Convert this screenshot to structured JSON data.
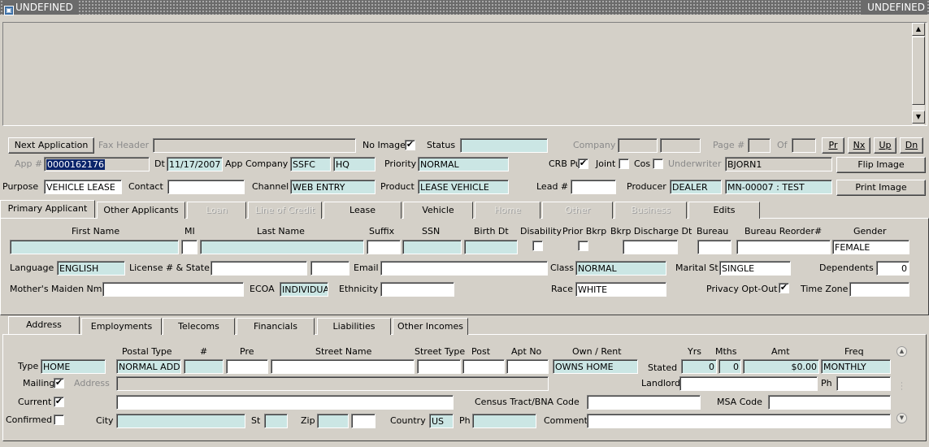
{
  "window": {
    "title": "UNDEFINED",
    "title_right": "UNDEFINED"
  },
  "header": {
    "next_application": "Next Application",
    "fax_header_label": "Fax Header",
    "fax_header_value": "",
    "no_image_label": "No Image",
    "no_image_checked": true,
    "status_label": "Status",
    "status_value": "",
    "company_label": "Company",
    "company_value1": "",
    "company_value2": "",
    "page_label": "Page #",
    "page_value": "",
    "of_label": "Of",
    "of_value": "",
    "nav_buttons": [
      "Pr",
      "Nx",
      "Up",
      "Dn"
    ],
    "app_label": "App #",
    "app_value": "0000162176",
    "dt_label": "Dt",
    "dt_value": "11/17/2007",
    "app_company_label": "App Company",
    "app_company_value": "SSFC",
    "app_company_branch": "HQ",
    "priority_label": "Priority",
    "priority_value": "NORMAL",
    "crb_pull_label": "CRB Pull",
    "crb_pull_checked": true,
    "joint_label": "Joint",
    "joint_checked": false,
    "cos_label": "Cos",
    "cos_checked": false,
    "underwriter_label": "Underwriter",
    "underwriter_value": "BJORN1",
    "flip_image": "Flip Image",
    "purpose_label": "Purpose",
    "purpose_value": "VEHICLE LEASE",
    "contact_label": "Contact",
    "contact_value": "",
    "channel_label": "Channel",
    "channel_value": "WEB ENTRY",
    "product_label": "Product",
    "product_value": "LEASE VEHICLE",
    "lead_label": "Lead #",
    "lead_value": "",
    "producer_label": "Producer",
    "producer_value": "DEALER",
    "producer_detail": "MN-00007 : TEST",
    "print_image": "Print Image"
  },
  "main_tabs": [
    {
      "label": "Primary Applicant",
      "state": "active"
    },
    {
      "label": "Other Applicants",
      "state": "normal"
    },
    {
      "label": "Loan",
      "state": "disabled"
    },
    {
      "label": "Line of Credit",
      "state": "disabled"
    },
    {
      "label": "Lease",
      "state": "normal"
    },
    {
      "label": "Vehicle",
      "state": "normal"
    },
    {
      "label": "Home",
      "state": "disabled"
    },
    {
      "label": "Other",
      "state": "disabled"
    },
    {
      "label": "Business",
      "state": "disabled"
    },
    {
      "label": "Edits",
      "state": "normal"
    }
  ],
  "applicant": {
    "headers": {
      "first_name": "First Name",
      "mi": "MI",
      "last_name": "Last Name",
      "suffix": "Suffix",
      "ssn": "SSN",
      "birth_dt": "Birth Dt",
      "disability": "Disability",
      "prior_bkrp": "Prior Bkrp",
      "bkrp_discharge_dt": "Bkrp Discharge Dt",
      "bureau": "Bureau",
      "bureau_reorder": "Bureau Reorder#",
      "gender": "Gender"
    },
    "first_name": "",
    "mi": "",
    "last_name": "",
    "suffix": "",
    "ssn": "",
    "birth_dt": "",
    "disability_checked": false,
    "prior_bkrp_checked": false,
    "bkrp_discharge_dt": "",
    "bureau": "",
    "bureau_reorder": "",
    "gender": "FEMALE",
    "language_label": "Language",
    "language_value": "ENGLISH",
    "license_label": "License # & State",
    "license_value": "",
    "license_state": "",
    "email_label": "Email",
    "email_value": "",
    "class_label": "Class",
    "class_value": "NORMAL",
    "marital_label": "Marital St",
    "marital_value": "SINGLE",
    "dependents_label": "Dependents",
    "dependents_value": "0",
    "maiden_label": "Mother's Maiden Nm",
    "maiden_value": "",
    "ecoa_label": "ECOA",
    "ecoa_value": "INDIVIDUAL",
    "ethnicity_label": "Ethnicity",
    "ethnicity_value": "",
    "race_label": "Race",
    "race_value": "WHITE",
    "privacy_label": "Privacy Opt-Out",
    "privacy_checked": true,
    "timezone_label": "Time Zone",
    "timezone_value": ""
  },
  "sub_tabs": [
    {
      "label": "Address",
      "state": "active"
    },
    {
      "label": "Employments",
      "state": "normal"
    },
    {
      "label": "Telecoms",
      "state": "normal"
    },
    {
      "label": "Financials",
      "state": "normal"
    },
    {
      "label": "Liabilities",
      "state": "normal"
    },
    {
      "label": "Other Incomes",
      "state": "normal"
    }
  ],
  "address": {
    "headers": {
      "postal_type": "Postal Type",
      "num": "#",
      "pre": "Pre",
      "street_name": "Street Name",
      "street_type": "Street Type",
      "post": "Post",
      "apt_no": "Apt No",
      "own_rent": "Own / Rent",
      "yrs": "Yrs",
      "mths": "Mths",
      "amt": "Amt",
      "freq": "Freq"
    },
    "type_label": "Type",
    "type_value": "HOME",
    "postal_type_value": "NORMAL ADDRESS",
    "num_value": "",
    "pre_value": "",
    "street_name_value": "",
    "street_type_value": "",
    "post_value": "",
    "apt_no_value": "",
    "own_rent_value": "OWNS HOME",
    "stated_label": "Stated",
    "yrs_value": "0",
    "mths_value": "0",
    "amt_value": "$0.00",
    "freq_value": "MONTHLY",
    "mailing_label": "Mailing",
    "mailing_checked": true,
    "address_label": "Address",
    "address_value": "",
    "landlord_label": "Landlord",
    "landlord_value": "",
    "ph_label": "Ph",
    "ph_value": "",
    "current_label": "Current",
    "current_checked": true,
    "current_line": "",
    "census_label": "Census Tract/BNA Code",
    "census_value": "",
    "msa_label": "MSA Code",
    "msa_value": "",
    "confirmed_label": "Confirmed",
    "confirmed_checked": false,
    "city_label": "City",
    "city_value": "",
    "st_label": "St",
    "st_value": "",
    "zip_label": "Zip",
    "zip_value": "",
    "zip_ext": "",
    "country_label": "Country",
    "country_value": "US",
    "ph2_label": "Ph",
    "ph2_value": "",
    "comment_label": "Comment",
    "comment_value": ""
  }
}
